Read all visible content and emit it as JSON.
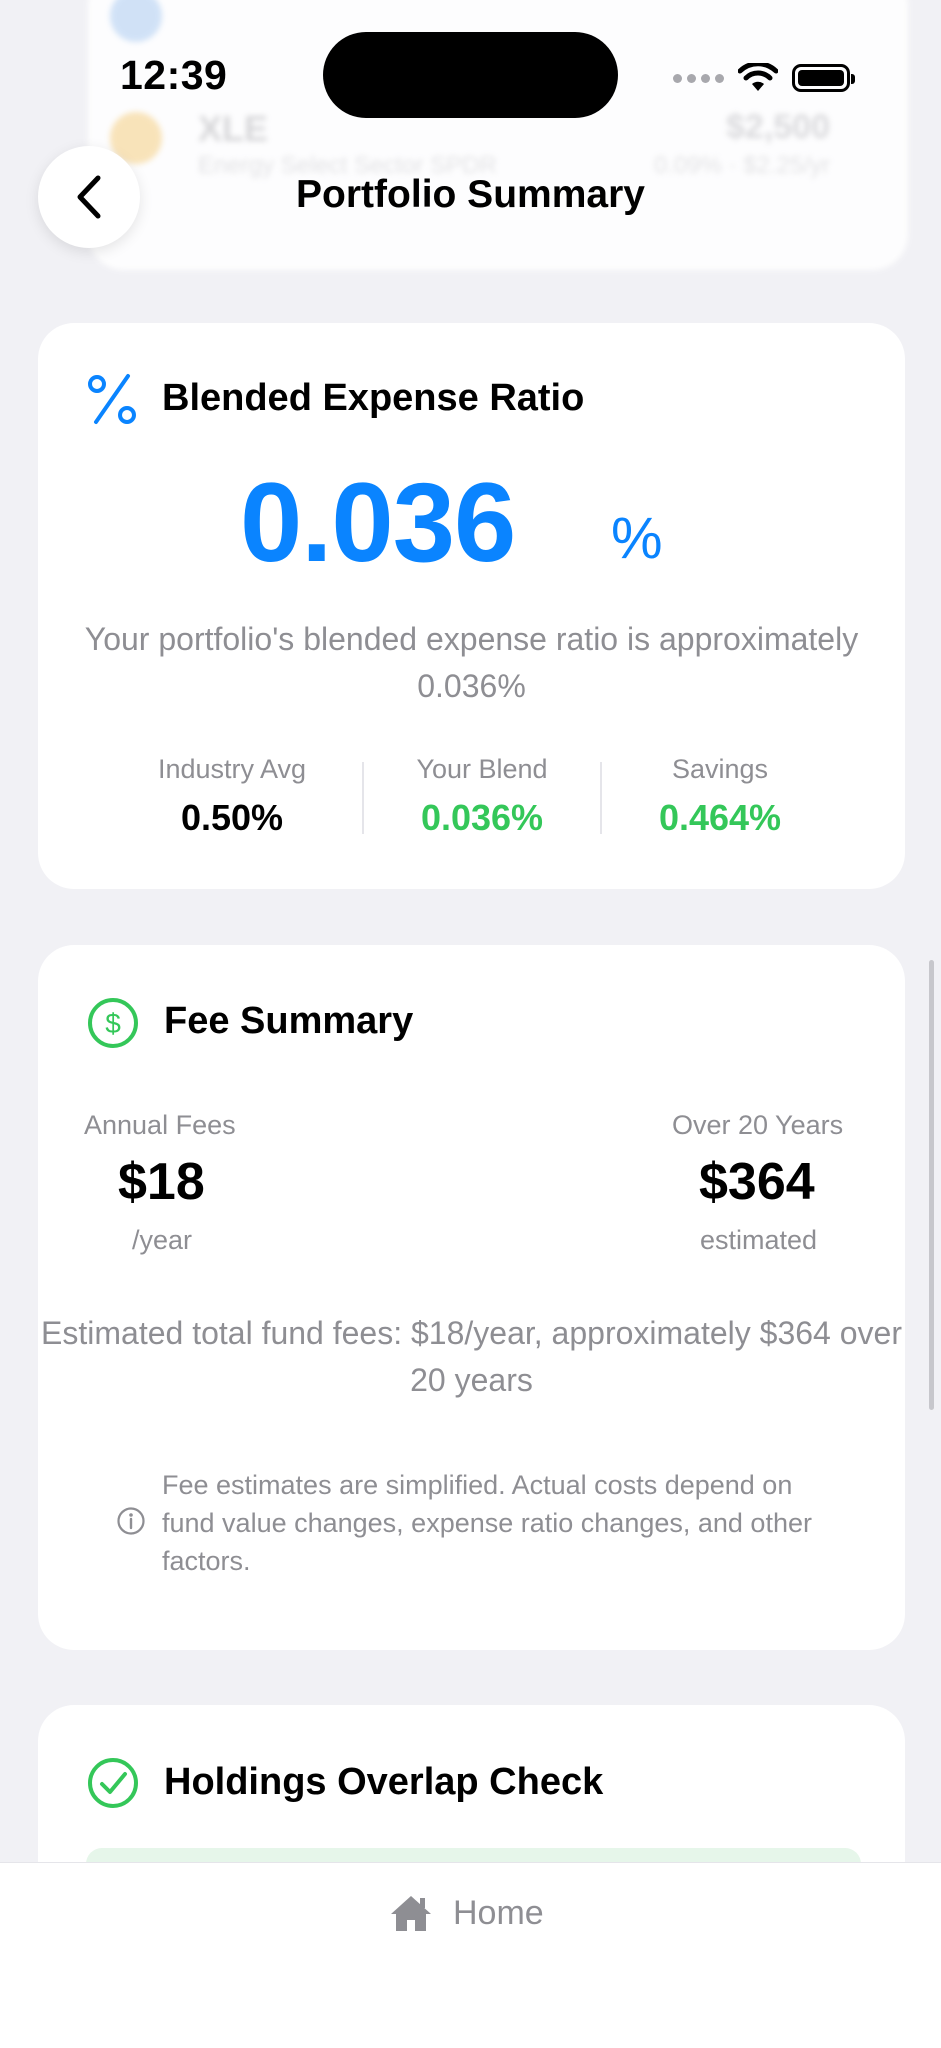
{
  "status_bar": {
    "time": "12:39"
  },
  "background_list": {
    "row": {
      "ticker": "XLE",
      "name": "Energy Select Sector SPDR",
      "amount": "$2,500",
      "detail": "0.09% · $2.25/yr"
    }
  },
  "header": {
    "title": "Portfolio Summary"
  },
  "expense_card": {
    "icon": "percent-icon",
    "title": "Blended Expense Ratio",
    "value": "0.036",
    "value_unit": "%",
    "description": "Your portfolio's blended expense ratio is approximately 0.036%",
    "stats": [
      {
        "label": "Industry Avg",
        "value": "0.50%"
      },
      {
        "label": "Your Blend",
        "value": "0.036%"
      },
      {
        "label": "Savings",
        "value": "0.464%"
      }
    ]
  },
  "fee_card": {
    "icon": "dollar-circle-icon",
    "title": "Fee Summary",
    "annual": {
      "label": "Annual Fees",
      "amount": "$18",
      "sub": "/year"
    },
    "long_term": {
      "label": "Over 20 Years",
      "amount": "$364",
      "sub": "estimated"
    },
    "description": "Estimated total fund fees: $18/year, approximately $364 over 20 years",
    "note": "Fee estimates are simplified. Actual costs depend on fund value changes, expense ratio changes, and other factors."
  },
  "overlap_card": {
    "icon": "check-circle-icon",
    "title": "Holdings Overlap Check"
  },
  "tab_bar": {
    "home_label": "Home"
  },
  "colors": {
    "accent_blue": "#0a84ff",
    "positive_green": "#34c759",
    "muted_gray": "#8e8e93"
  }
}
